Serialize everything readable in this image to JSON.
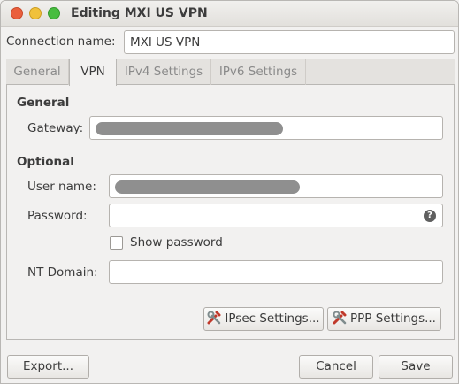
{
  "window": {
    "title": "Editing MXI US VPN"
  },
  "connection": {
    "name_label": "Connection name:",
    "name_value": "MXI US VPN"
  },
  "tabs": [
    {
      "label": "General"
    },
    {
      "label": "VPN"
    },
    {
      "label": "IPv4 Settings"
    },
    {
      "label": "IPv6 Settings"
    }
  ],
  "vpn": {
    "general_heading": "General",
    "gateway_label": "Gateway:",
    "optional_heading": "Optional",
    "username_label": "User name:",
    "password_label": "Password:",
    "show_password_label": "Show password",
    "show_password_checked": false,
    "nt_domain_label": "NT Domain:",
    "nt_domain_value": "",
    "ipsec_button": "IPsec Settings...",
    "ppp_button": "PPP Settings..."
  },
  "footer": {
    "export_button": "Export...",
    "cancel_button": "Cancel",
    "save_button": "Save"
  },
  "icons": {
    "password_hint": "question-icon",
    "ipsec": "tools-icon",
    "ppp": "tools-icon"
  }
}
